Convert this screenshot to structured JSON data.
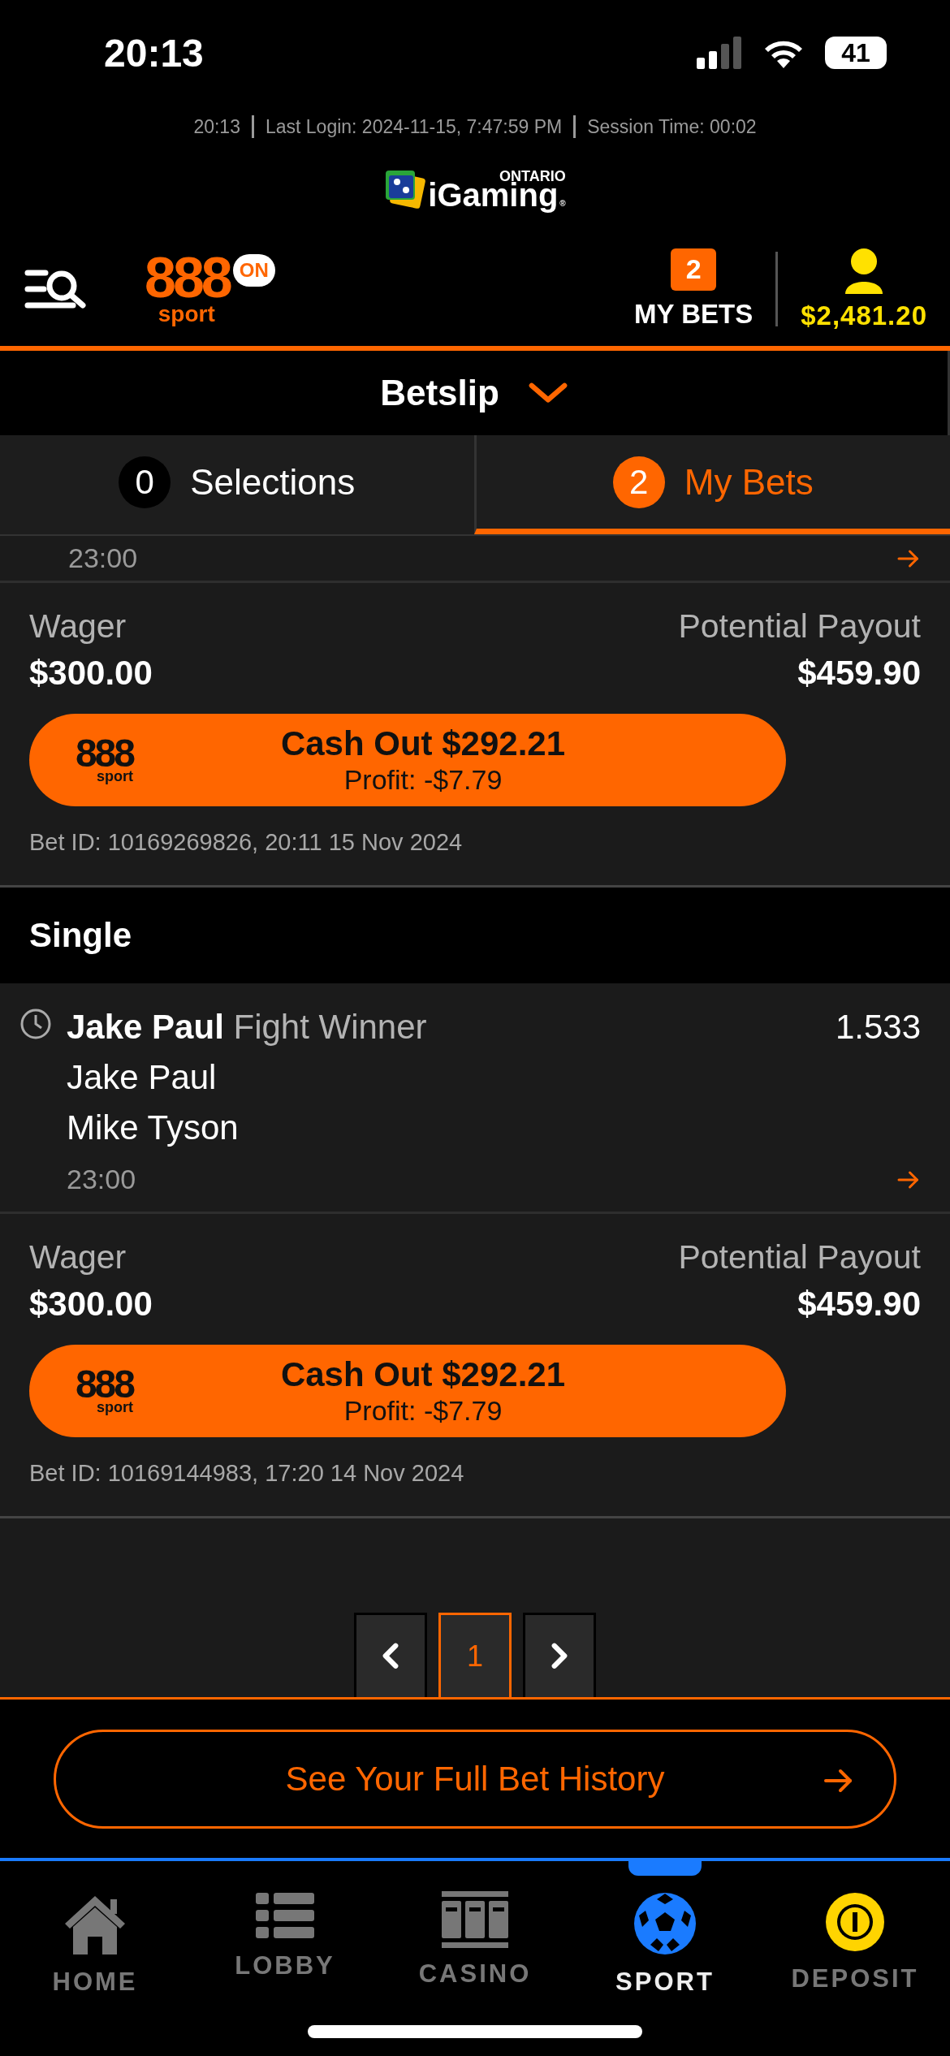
{
  "status_bar": {
    "time": "20:13",
    "battery": "41"
  },
  "session_info": {
    "clock": "20:13",
    "last_login": "Last Login: 2024-11-15, 7:47:59 PM",
    "session_time": "Session Time: 00:02"
  },
  "regulator_logo": {
    "region": "ONTARIO",
    "name": "iGaming",
    "mark": "®"
  },
  "header": {
    "brand": "888",
    "brand_sub": "sport",
    "badge": "ON",
    "my_bets_count": "2",
    "my_bets_label": "MY BETS",
    "balance": "$2,481.20"
  },
  "betslip": {
    "title": "Betslip"
  },
  "tabs": [
    {
      "count": "0",
      "label": "Selections",
      "selected": false
    },
    {
      "count": "2",
      "label": "My Bets",
      "selected": true
    }
  ],
  "blocks": [
    {
      "kind": "selection_tail",
      "time": "23:00"
    },
    {
      "kind": "wager",
      "wager_label": "Wager",
      "wager": "$300.00",
      "payout_label": "Potential Payout",
      "payout": "$459.90",
      "logo": "888",
      "logo_sub": "sport",
      "cash_out": "Cash Out $292.21",
      "profit": "Profit: -$7.79",
      "bet_id": "Bet ID: 10169269826, 20:11 15 Nov 2024"
    },
    {
      "kind": "section",
      "title": "Single"
    },
    {
      "kind": "selection",
      "name": "Jake Paul",
      "market": "Fight Winner",
      "odds": "1.533",
      "participants": [
        "Jake Paul",
        "Mike Tyson"
      ],
      "time": "23:00"
    },
    {
      "kind": "wager",
      "wager_label": "Wager",
      "wager": "$300.00",
      "payout_label": "Potential Payout",
      "payout": "$459.90",
      "logo": "888",
      "logo_sub": "sport",
      "cash_out": "Cash Out $292.21",
      "profit": "Profit: -$7.79",
      "bet_id": "Bet ID: 10169144983, 17:20 14 Nov 2024"
    }
  ],
  "pagination": {
    "page": "1"
  },
  "history_button": {
    "label": "See Your Full Bet History"
  },
  "nav": [
    {
      "kind": "home",
      "label": "HOME",
      "selected": false
    },
    {
      "kind": "lobby",
      "label": "LOBBY",
      "selected": false
    },
    {
      "kind": "casino",
      "label": "CASINO",
      "selected": false
    },
    {
      "kind": "sport",
      "label": "SPORT",
      "selected": true
    },
    {
      "kind": "deposit",
      "label": "DEPOSIT",
      "selected": false
    }
  ]
}
